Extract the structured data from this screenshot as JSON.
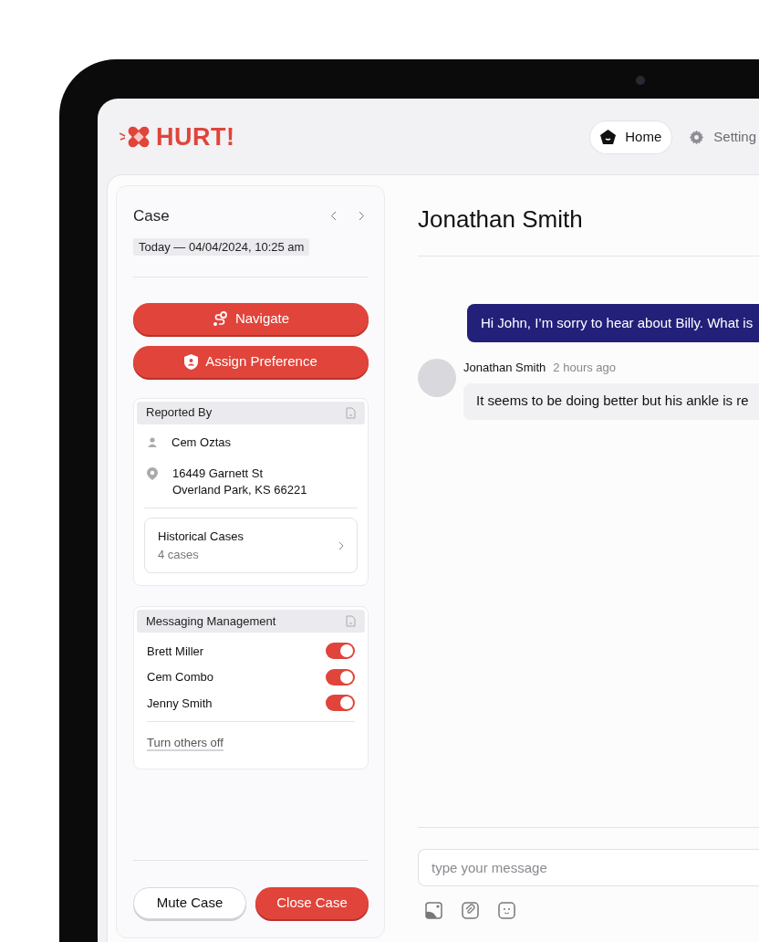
{
  "header": {
    "logo": "HURT!",
    "nav": [
      {
        "label": "Home",
        "selected": true
      },
      {
        "label": "Setting",
        "selected": false
      }
    ]
  },
  "case_panel": {
    "title": "Case",
    "date": "Today — 04/04/2024, 10:25 am",
    "actions": [
      "Navigate",
      "Assign Preference"
    ],
    "reported_by": {
      "title": "Reported By",
      "name": "Cem Oztas",
      "address": [
        "16449 Garnett St",
        "Overland Park, KS 66221"
      ],
      "historical": {
        "title": "Historical Cases",
        "count": "4 cases"
      }
    },
    "messaging": {
      "title": "Messaging Management",
      "people": [
        {
          "name": "Brett Miller",
          "on": true
        },
        {
          "name": "Cem Combo",
          "on": true
        },
        {
          "name": "Jenny Smith",
          "on": true
        }
      ],
      "link": "Turn others off"
    },
    "footer_buttons": [
      {
        "label": "Mute Case",
        "kind": "outline"
      },
      {
        "label": "Close Case",
        "kind": "primary"
      }
    ]
  },
  "chat": {
    "title": "Jonathan Smith",
    "messages": [
      {
        "kind": "outgoing",
        "text": "Hi John, I’m sorry to hear about Billy. What is"
      },
      {
        "kind": "incoming",
        "sender": "Jonathan Smith",
        "time": "2 hours ago",
        "text": "It seems to be doing better but his ankle is re"
      }
    ],
    "composer": {
      "placeholder": "type your message"
    }
  }
}
